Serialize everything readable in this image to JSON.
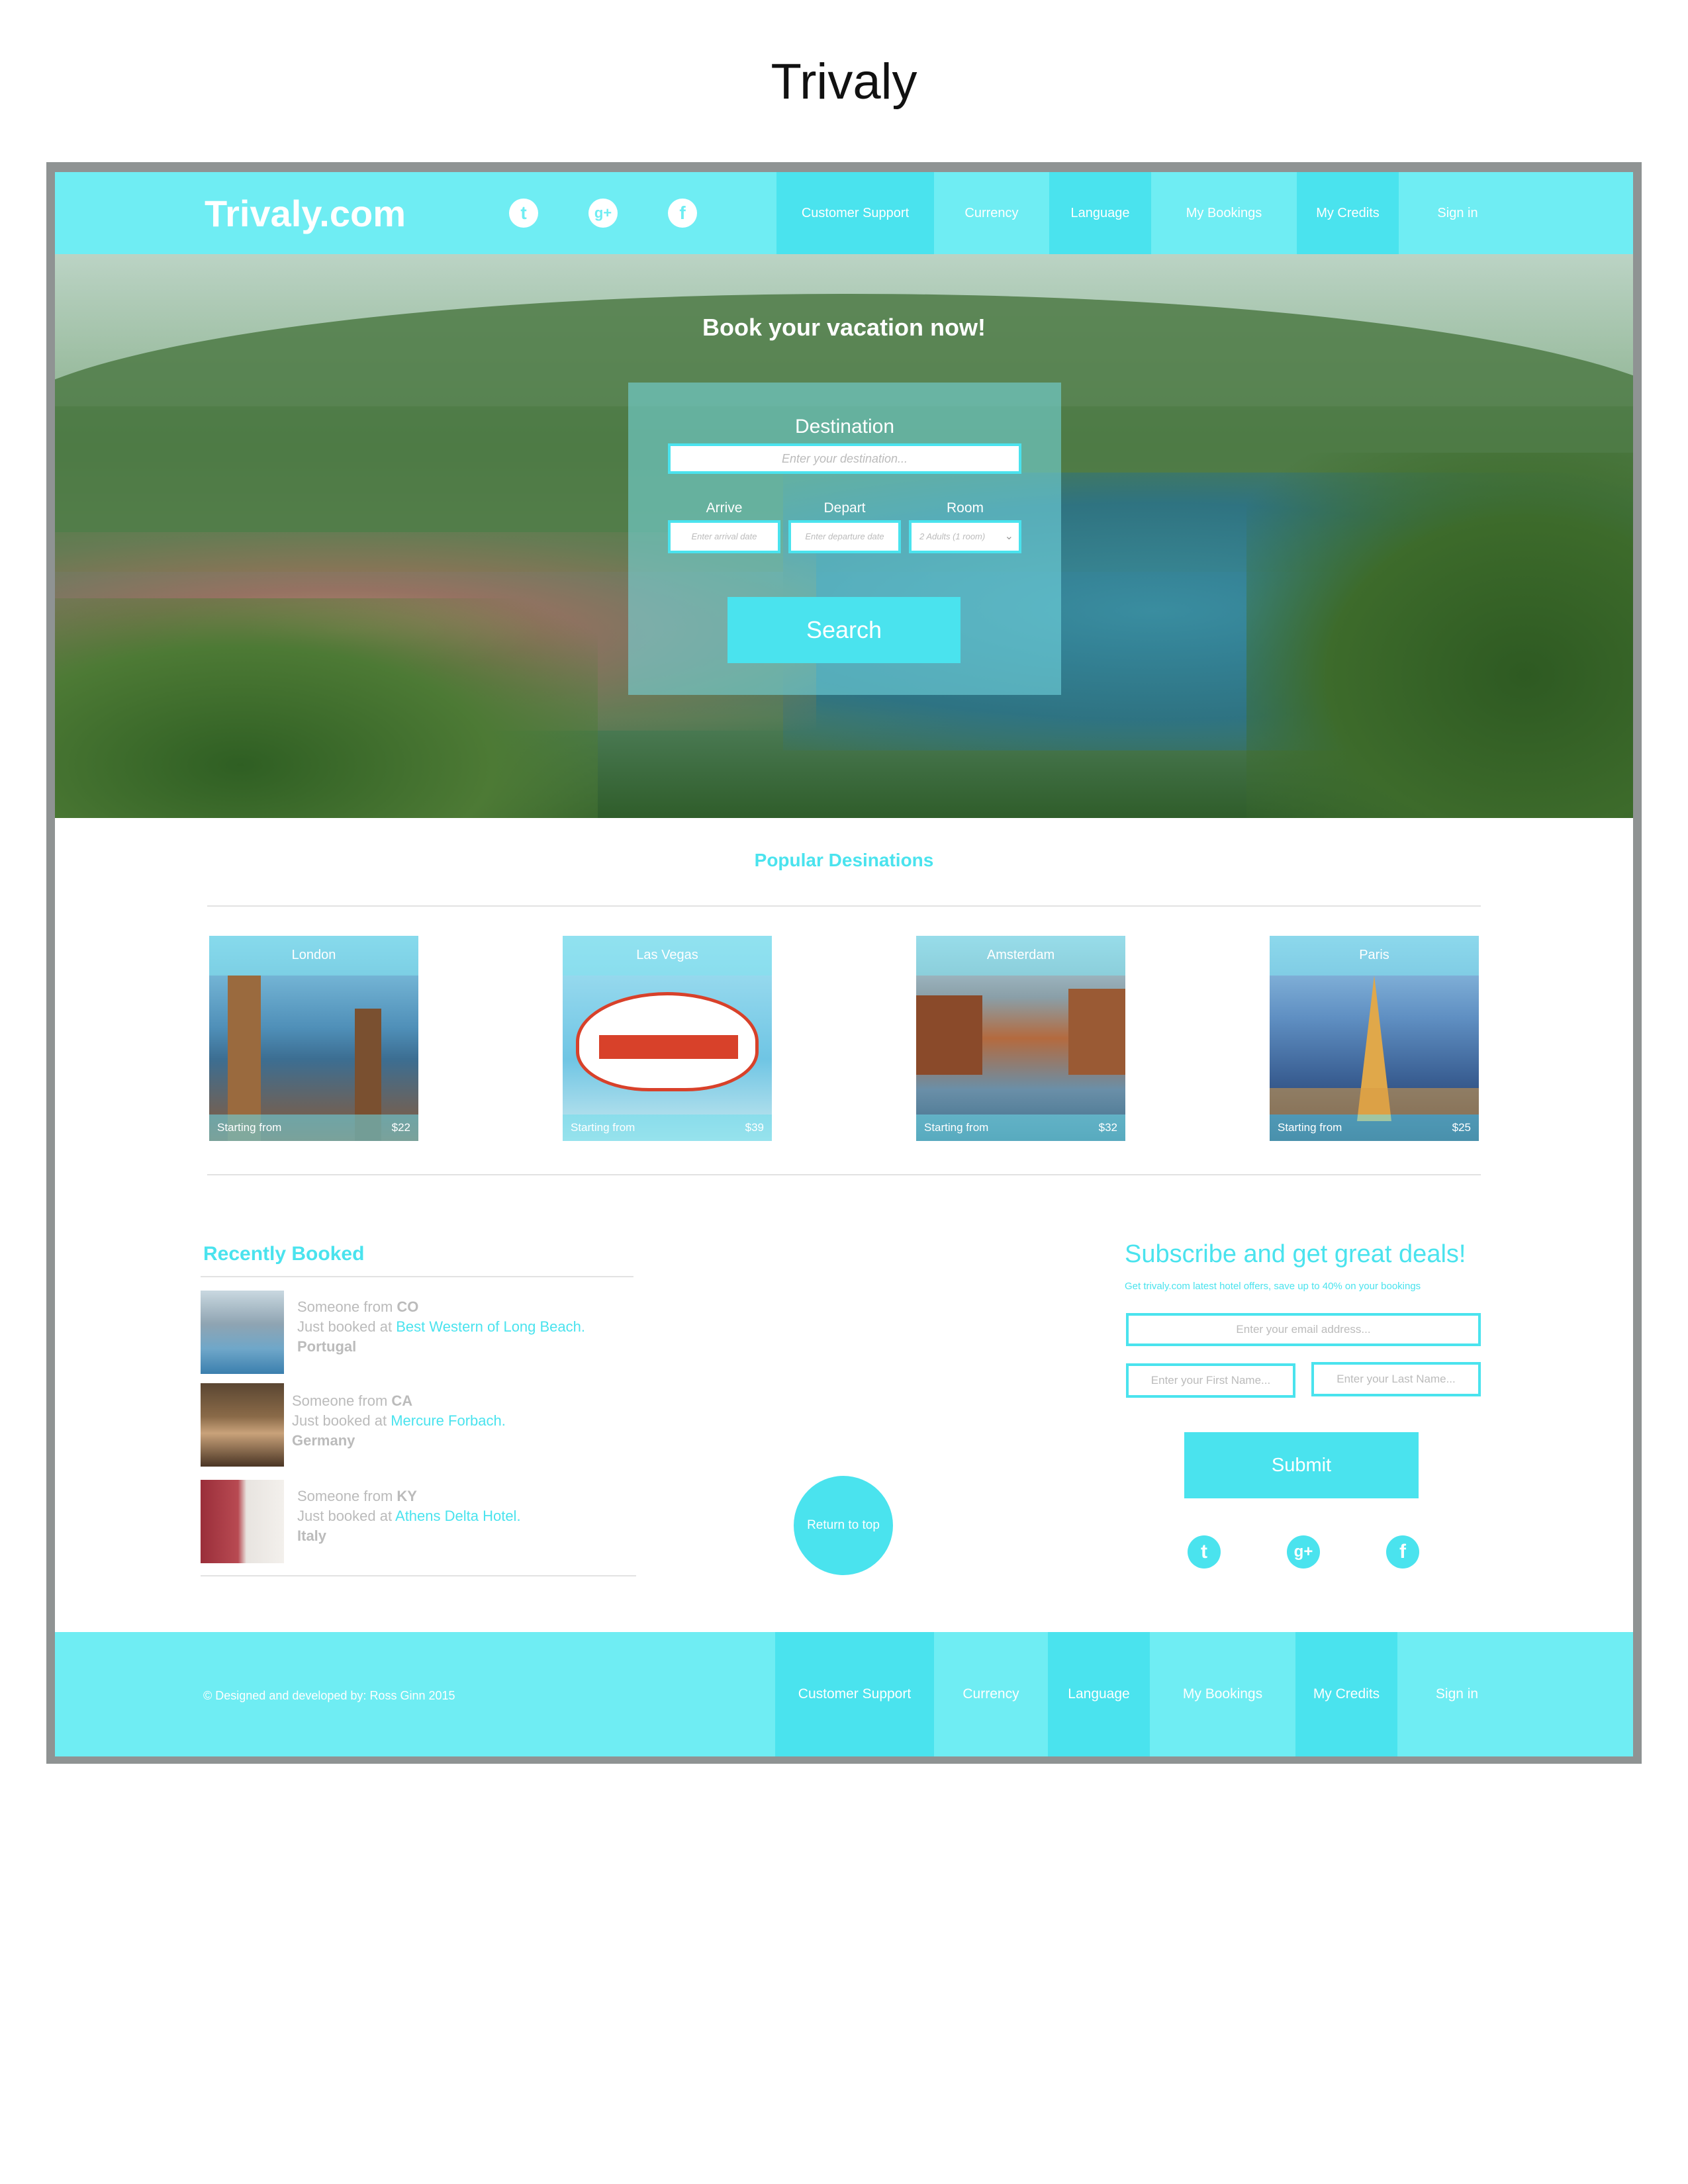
{
  "doc_title": "Trivaly",
  "header": {
    "logo": "Trivaly.com",
    "social": [
      {
        "icon": "twitter-icon",
        "glyph": "t"
      },
      {
        "icon": "google-plus-icon",
        "glyph": "g+"
      },
      {
        "icon": "facebook-icon",
        "glyph": "f"
      }
    ],
    "nav": [
      "Customer Support",
      "Currency",
      "Language",
      "My Bookings",
      "My Credits",
      "Sign in"
    ]
  },
  "hero": {
    "title": "Book your vacation now!",
    "destination_label": "Destination",
    "destination_placeholder": "Enter your destination...",
    "arrive_label": "Arrive",
    "arrive_placeholder": "Enter arrival date",
    "depart_label": "Depart",
    "depart_placeholder": "Enter departure date",
    "room_label": "Room",
    "room_value": "2 Adults (1 room)",
    "search_label": "Search"
  },
  "popular": {
    "title": "Popular Desinations",
    "cards": [
      {
        "name": "London",
        "from": "Starting from",
        "price": "$22",
        "colors": [
          "#7fc4de",
          "#3f7fa8",
          "#a07048"
        ]
      },
      {
        "name": "Las Vegas",
        "from": "Starting from",
        "price": "$39",
        "colors": [
          "#8fd8ee",
          "#ffffff",
          "#d8412a"
        ]
      },
      {
        "name": "Amsterdam",
        "from": "Starting from",
        "price": "$32",
        "colors": [
          "#9cc3d6",
          "#b46a3e",
          "#3f6e8a"
        ]
      },
      {
        "name": "Paris",
        "from": "Starting from",
        "price": "$25",
        "colors": [
          "#7fb8e0",
          "#3a5f93",
          "#e0a84a"
        ]
      }
    ]
  },
  "recent": {
    "title": "Recently Booked",
    "items": [
      {
        "someone": "Someone from",
        "state": "CO",
        "booked": "Just booked at",
        "hotel": "Best Western of Long Beach.",
        "country": "Portugal",
        "img_color": "#6fa7c9"
      },
      {
        "someone": "Someone from",
        "state": "CA",
        "booked": "Just booked at",
        "hotel": "Mercure Forbach.",
        "country": "Germany",
        "img_color": "#7a5a3a"
      },
      {
        "someone": "Someone from",
        "state": "KY",
        "booked": "Just booked at",
        "hotel": "Athens Delta Hotel.",
        "country": "Italy",
        "img_color": "#9a2e3a"
      }
    ]
  },
  "return_to_top": "Return to top",
  "subscribe": {
    "title": "Subscribe and get great deals!",
    "subtitle": "Get trivaly.com latest hotel offers, save up to 40% on your bookings",
    "email_placeholder": "Enter your email address...",
    "first_name_placeholder": "Enter your First Name...",
    "last_name_placeholder": "Enter your Last Name...",
    "submit_label": "Submit"
  },
  "footer": {
    "copyright": "© Designed and developed by: Ross Ginn 2015",
    "nav": [
      "Customer Support",
      "Currency",
      "Language",
      "My Bookings",
      "My Credits",
      "Sign in"
    ]
  },
  "colors": {
    "accent": "#4ae3ee",
    "accent_light": "#6fedf3",
    "frame": "#8f9393"
  }
}
